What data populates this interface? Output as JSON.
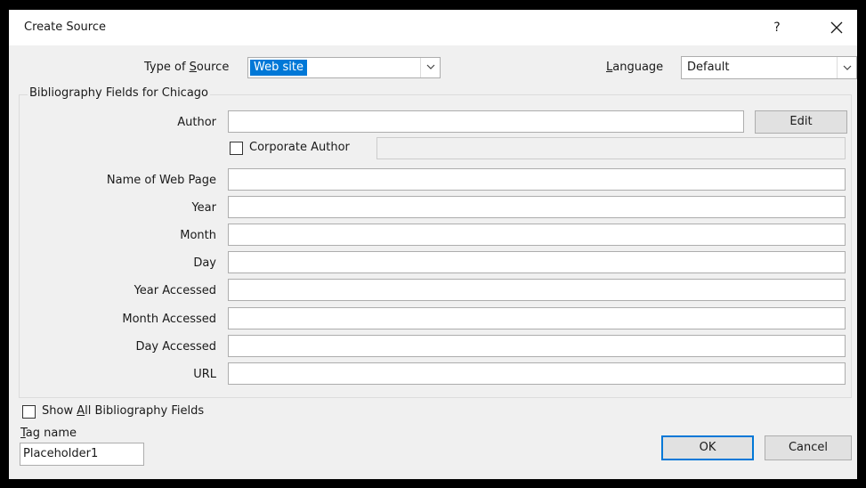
{
  "window": {
    "title": "Create Source",
    "help_glyph": "?"
  },
  "source_type": {
    "label_pre": "Type of ",
    "label_key": "S",
    "label_post": "ource",
    "value": "Web site"
  },
  "language": {
    "label_key": "L",
    "label_post": "anguage",
    "value": "Default"
  },
  "group": {
    "legend": "Bibliography Fields for Chicago"
  },
  "author": {
    "label": "Author",
    "value": "",
    "edit_label": "Edit",
    "corporate_label": "Corporate Author",
    "corporate_checked": false
  },
  "fields": [
    {
      "label": "Name of Web Page",
      "value": ""
    },
    {
      "label": "Year",
      "value": ""
    },
    {
      "label": "Month",
      "value": ""
    },
    {
      "label": "Day",
      "value": ""
    },
    {
      "label": "Year Accessed",
      "value": ""
    },
    {
      "label": "Month Accessed",
      "value": ""
    },
    {
      "label": "Day Accessed",
      "value": ""
    },
    {
      "label": "URL",
      "value": ""
    }
  ],
  "show_all": {
    "label_pre": "Show ",
    "label_key": "A",
    "label_post": "ll Bibliography Fields",
    "checked": false
  },
  "tag": {
    "label_key": "T",
    "label_post": "ag name",
    "value": "Placeholder1"
  },
  "buttons": {
    "ok": "OK",
    "cancel": "Cancel"
  }
}
